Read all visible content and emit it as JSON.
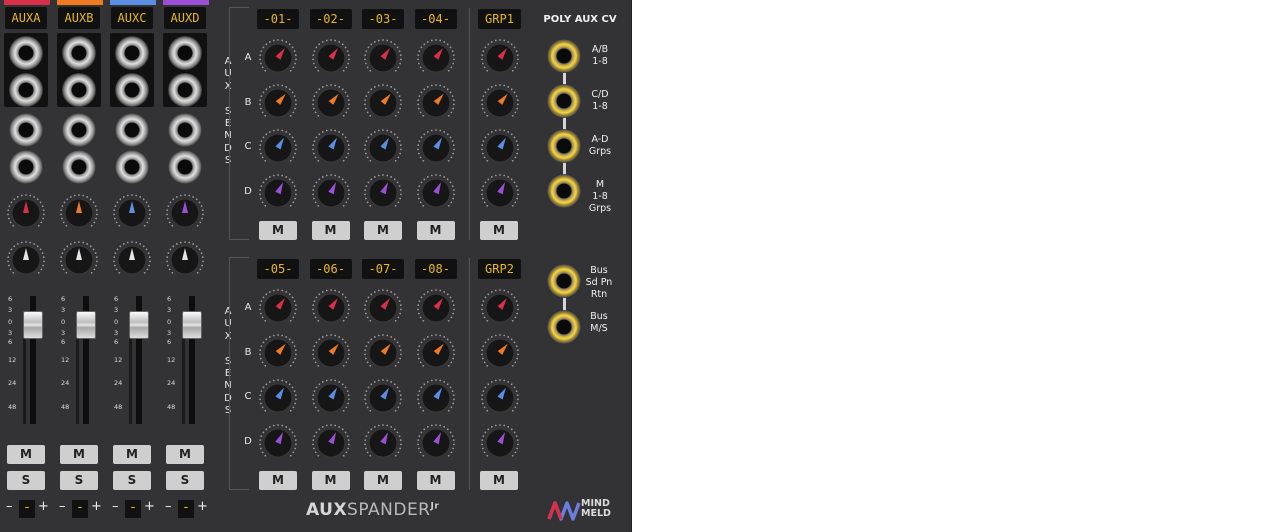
{
  "aux_channels": [
    {
      "label": "AUXA",
      "color": "#d9304a",
      "mute": "M",
      "solo": "S"
    },
    {
      "label": "AUXB",
      "color": "#f07a21",
      "mute": "M",
      "solo": "S"
    },
    {
      "label": "AUXC",
      "color": "#5d8ee6",
      "mute": "M",
      "solo": "S"
    },
    {
      "label": "AUXD",
      "color": "#9b4fd6",
      "mute": "M",
      "solo": "S"
    }
  ],
  "fader_scale": [
    "6",
    "3",
    "0",
    "3",
    "6",
    "12",
    "24",
    "48"
  ],
  "trim": {
    "minus": "–",
    "value": "-",
    "plus": "+"
  },
  "vertical_label": [
    "A",
    "U",
    "X",
    "",
    "S",
    "E",
    "N",
    "D",
    "S"
  ],
  "send_rows": [
    "A",
    "B",
    "C",
    "D"
  ],
  "top_section": {
    "tracks": [
      "-01-",
      "-02-",
      "-03-",
      "-04-"
    ],
    "group": "GRP1",
    "mute": "M"
  },
  "bottom_section": {
    "tracks": [
      "-05-",
      "-06-",
      "-07-",
      "-08-"
    ],
    "group": "GRP2",
    "mute": "M"
  },
  "poly_aux_cv": {
    "title": "POLY AUX CV",
    "jacks": [
      {
        "lines": [
          "A/B",
          "1-8"
        ]
      },
      {
        "lines": [
          "C/D",
          "1-8"
        ]
      },
      {
        "lines": [
          "A-D",
          "Grps"
        ]
      },
      {
        "lines": [
          "M",
          "1-8",
          "Grps"
        ]
      }
    ],
    "bus_jacks": [
      {
        "lines": [
          "Bus",
          "Sd Pn",
          "Rtn"
        ]
      },
      {
        "lines": [
          "Bus",
          "M/S"
        ]
      }
    ]
  },
  "branding": {
    "product_bold": "AUX",
    "product_light": "SPANDER",
    "suffix": "Jr",
    "maker_line1": "MIND",
    "maker_line2": "MELD"
  }
}
